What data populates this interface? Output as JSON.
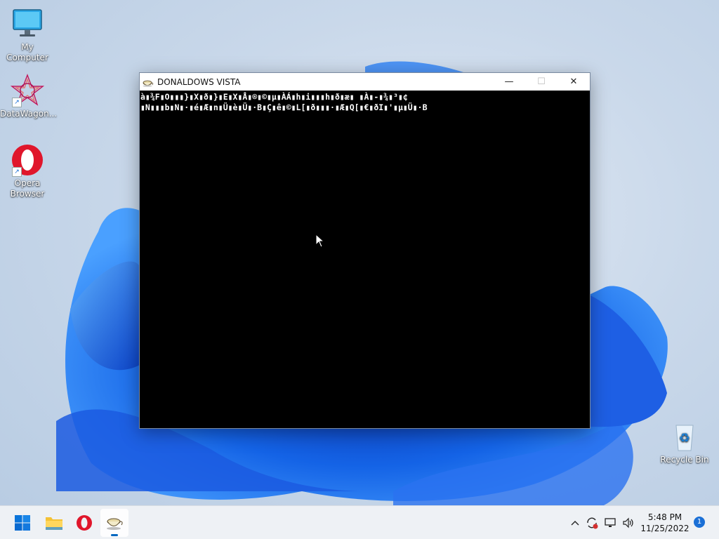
{
  "desktop": {
    "icons": [
      {
        "label": "My Computer"
      },
      {
        "label": "DataWagon..."
      },
      {
        "label": "Opera Browser"
      },
      {
        "label": "Recycle Bin"
      }
    ]
  },
  "window": {
    "title": "DONALDOWS VISTA",
    "console_lines": [
      "à▮¾F▮O▮▮▮}▮X▮ð▮}▮E▮X▮Å▮®▮©▮µ▮ÀÁ▮h▮i▮▮▮h▮ð▮æ▮ ▮À▮-▮¾▮³▮¢",
      "▮N▮▮▮b▮N▮·▮é▮Æ▮n▮Ü▮è▮Ü▮·B▮Ç▮ê▮©▮L[▮ð▮▮▮·▮Æ▮Q[▮€▮ðI▮'▮µ▮Ü▮·B"
    ],
    "minimize_glyph": "—",
    "maximize_glyph": "☐",
    "close_glyph": "✕"
  },
  "taskbar": {
    "time": "5:48 PM",
    "date": "11/25/2022",
    "notification_count": "1"
  },
  "colors": {
    "accent": "#0067c0",
    "wallpaper_blue": "#1257d9"
  }
}
